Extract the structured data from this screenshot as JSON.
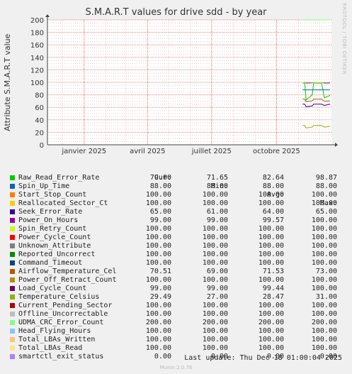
{
  "chart_data": {
    "type": "line",
    "title": "S.M.A.R.T values for drive sdd - by year",
    "ylabel": "Attribute S.M.A.R.T value",
    "ylim": [
      0,
      200
    ],
    "yticks": [
      0,
      20,
      40,
      60,
      80,
      100,
      120,
      140,
      160,
      180,
      200
    ],
    "xlim": [
      "2024-11-10",
      "2025-12-18"
    ],
    "xticks": [
      {
        "label": "janvier 2025",
        "date": "2025-01-01"
      },
      {
        "label": "avril 2025",
        "date": "2025-04-01"
      },
      {
        "label": "juillet 2025",
        "date": "2025-07-01"
      },
      {
        "label": "octobre 2025",
        "date": "2025-10-01"
      }
    ],
    "data_start": "2025-11-07",
    "legend_headers": [
      "Cur:",
      "Min:",
      "Avg:",
      "Max:"
    ],
    "series": [
      {
        "name": "Raw_Read_Error_Rate",
        "color": "#00cc00",
        "cur": "79.00",
        "min": "71.65",
        "avg": "82.64",
        "max": "98.87"
      },
      {
        "name": "Spin_Up_Time",
        "color": "#0066b3",
        "cur": "88.00",
        "min": "88.00",
        "avg": "88.00",
        "max": "88.00"
      },
      {
        "name": "Start_Stop_Count",
        "color": "#ff8000",
        "cur": "100.00",
        "min": "100.00",
        "avg": "100.00",
        "max": "100.00"
      },
      {
        "name": "Reallocated_Sector_Ct",
        "color": "#ffcc00",
        "cur": "100.00",
        "min": "100.00",
        "avg": "100.00",
        "max": "100.00"
      },
      {
        "name": "Seek_Error_Rate",
        "color": "#330099",
        "cur": "65.00",
        "min": "61.00",
        "avg": "64.00",
        "max": "65.00"
      },
      {
        "name": "Power_On_Hours",
        "color": "#990099",
        "cur": "99.00",
        "min": "99.00",
        "avg": "99.57",
        "max": "100.00"
      },
      {
        "name": "Spin_Retry_Count",
        "color": "#ccff00",
        "cur": "100.00",
        "min": "100.00",
        "avg": "100.00",
        "max": "100.00"
      },
      {
        "name": "Power_Cycle_Count",
        "color": "#ff0000",
        "cur": "100.00",
        "min": "100.00",
        "avg": "100.00",
        "max": "100.00"
      },
      {
        "name": "Unknown_Attribute",
        "color": "#808080",
        "cur": "100.00",
        "min": "100.00",
        "avg": "100.00",
        "max": "100.00"
      },
      {
        "name": "Reported_Uncorrect",
        "color": "#008f00",
        "cur": "100.00",
        "min": "100.00",
        "avg": "100.00",
        "max": "100.00"
      },
      {
        "name": "Command_Timeout",
        "color": "#00487d",
        "cur": "100.00",
        "min": "100.00",
        "avg": "100.00",
        "max": "100.00"
      },
      {
        "name": "Airflow_Temperature_Cel",
        "color": "#b35a00",
        "cur": "70.51",
        "min": "69.00",
        "avg": "71.53",
        "max": "73.00"
      },
      {
        "name": "Power_Off_Retract_Count",
        "color": "#b38f00",
        "cur": "100.00",
        "min": "100.00",
        "avg": "100.00",
        "max": "100.00"
      },
      {
        "name": "Load_Cycle_Count",
        "color": "#6b006b",
        "cur": "99.00",
        "min": "99.00",
        "avg": "99.44",
        "max": "100.00"
      },
      {
        "name": "Temperature_Celsius",
        "color": "#8fb300",
        "cur": "29.49",
        "min": "27.00",
        "avg": "28.47",
        "max": "31.00"
      },
      {
        "name": "Current_Pending_Sector",
        "color": "#b30000",
        "cur": "100.00",
        "min": "100.00",
        "avg": "100.00",
        "max": "100.00"
      },
      {
        "name": "Offline_Uncorrectable",
        "color": "#bebebe",
        "cur": "100.00",
        "min": "100.00",
        "avg": "100.00",
        "max": "100.00"
      },
      {
        "name": "UDMA_CRC_Error_Count",
        "color": "#80ff80",
        "cur": "200.00",
        "min": "200.00",
        "avg": "200.00",
        "max": "200.00"
      },
      {
        "name": "Head_Flying_Hours",
        "color": "#80c9ff",
        "cur": "100.00",
        "min": "100.00",
        "avg": "100.00",
        "max": "100.00"
      },
      {
        "name": "Total_LBAs_Written",
        "color": "#ffc080",
        "cur": "100.00",
        "min": "100.00",
        "avg": "100.00",
        "max": "100.00"
      },
      {
        "name": "Total_LBAs_Read",
        "color": "#ffe680",
        "cur": "100.00",
        "min": "100.00",
        "avg": "100.00",
        "max": "100.00"
      },
      {
        "name": "smartctl_exit_status",
        "color": "#aa80ff",
        "cur": "0.00",
        "min": "0.00",
        "avg": "0.00",
        "max": "0.00"
      }
    ]
  },
  "watermark": "RRDTOOL / TOBI OETIKER",
  "last_update": "Last update: Thu Dec 18 01:00:04 2025",
  "munin_version": "Munin 2.0.76"
}
